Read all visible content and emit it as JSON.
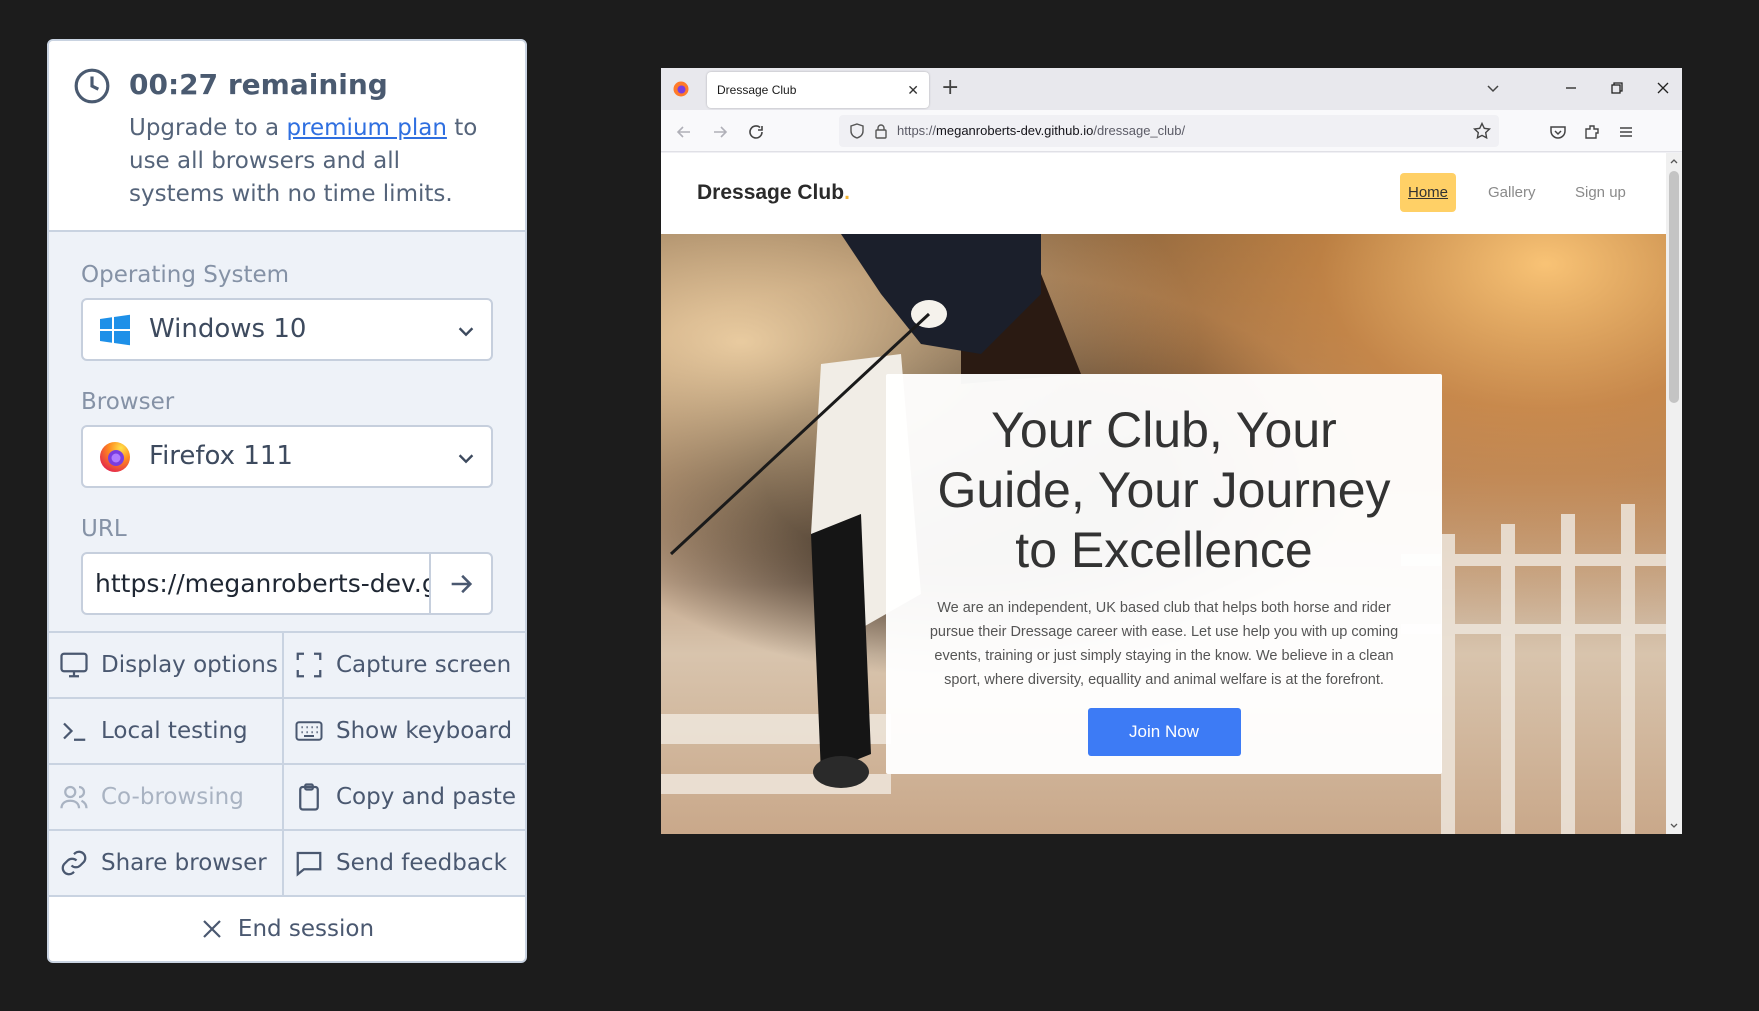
{
  "panel": {
    "timer_title": "00:27 remaining",
    "upgrade_pre": "Upgrade to a",
    "upgrade_link": "premium plan",
    "upgrade_post": "to use all browsers and all systems with no time limits.",
    "os_label": "Operating System",
    "os_value": "Windows 10",
    "browser_label": "Browser",
    "browser_value": "Firefox 111",
    "url_label": "URL",
    "url_value": "https://meganroberts-dev.github.io/dressage_club/",
    "actions": {
      "display": "Display options",
      "capture": "Capture screen",
      "local": "Local testing",
      "keyboard": "Show keyboard",
      "cobrowse": "Co-browsing",
      "copy": "Copy and paste",
      "share": "Share browser",
      "feedback": "Send feedback"
    },
    "end_session": "End session"
  },
  "browser": {
    "tab_title": "Dressage Club",
    "address_prefix": "https://",
    "address_host": "meganroberts-dev.github.io",
    "address_path": "/dressage_club/"
  },
  "site": {
    "logo": "Dressage Club",
    "logo_dot": ".",
    "nav": [
      "Home",
      "Gallery",
      "Sign up"
    ],
    "hero_title": "Your Club, Your Guide, Your Journey to Excellence",
    "hero_text": "We are an independent, UK based club that helps both horse and rider pursue their Dressage career with ease. Let use help you with up coming events, training or just simply staying in the know. We believe in a clean sport, where diversity, equallity and animal welfare is at the forefront.",
    "cta": "Join Now"
  },
  "colors": {
    "accent_link": "#2f6fe0",
    "nav_active": "#ffd066",
    "cta": "#3d7bf5"
  }
}
